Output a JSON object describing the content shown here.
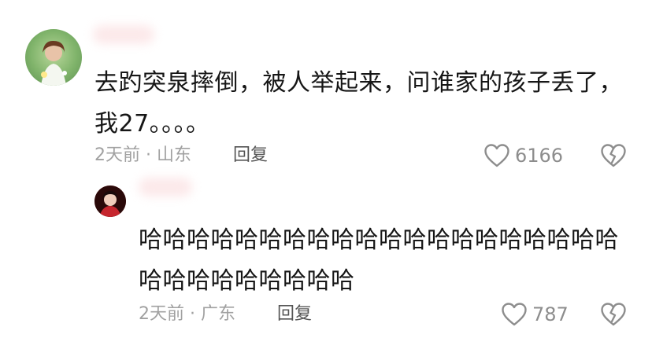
{
  "comments": [
    {
      "text": "去趵突泉摔倒，被人举起来，问谁家的孩子丢了，我27。。。。",
      "time": "2天前",
      "separator": "·",
      "location": "山东",
      "reply_label": "回复",
      "likes": "6166"
    },
    {
      "text": "哈哈哈哈哈哈哈哈哈哈哈哈哈哈哈哈哈哈哈哈哈哈哈哈哈哈哈哈哈",
      "time": "2天前",
      "separator": "·",
      "location": "广东",
      "reply_label": "回复",
      "likes": "787"
    }
  ],
  "colors": {
    "text": "#161616",
    "meta": "#a1a1a1",
    "icon": "#8d8d8d"
  }
}
